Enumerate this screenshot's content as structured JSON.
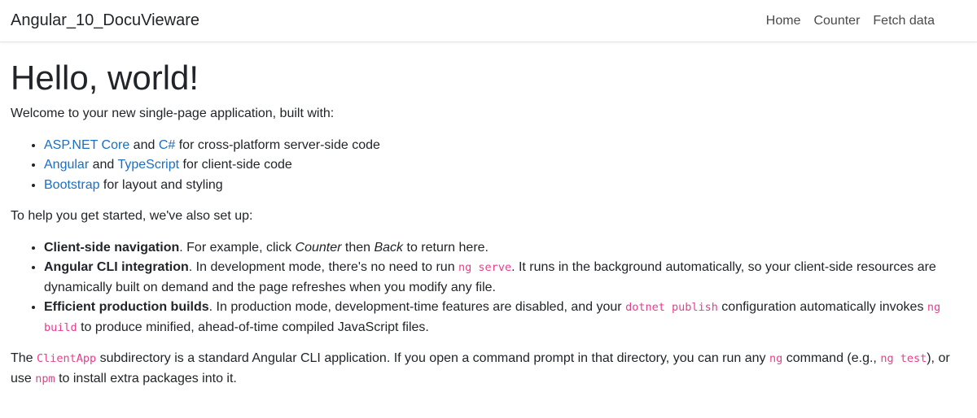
{
  "navbar": {
    "brand": "Angular_10_DocuVieware",
    "links": [
      "Home",
      "Counter",
      "Fetch data"
    ]
  },
  "main": {
    "title": "Hello, world!",
    "intro": "Welcome to your new single-page application, built with:",
    "built_with": [
      {
        "link1": "ASP.NET Core",
        "mid": " and ",
        "link2": "C#",
        "rest": " for cross-platform server-side code"
      },
      {
        "link1": "Angular",
        "mid": " and ",
        "link2": "TypeScript",
        "rest": " for client-side code"
      },
      {
        "link1": "Bootstrap",
        "rest": " for layout and styling"
      }
    ],
    "setup_intro": "To help you get started, we've also set up:",
    "setup_items": [
      {
        "strong": "Client-side navigation",
        "t1": ". For example, click ",
        "em1": "Counter",
        "t2": " then ",
        "em2": "Back",
        "t3": " to return here."
      },
      {
        "strong": "Angular CLI integration",
        "t1": ". In development mode, there's no need to run ",
        "code1": "ng serve",
        "t2": ". It runs in the background automatically, so your client-side resources are dynamically built on demand and the page refreshes when you modify any file."
      },
      {
        "strong": "Efficient production builds",
        "t1": ". In production mode, development-time features are disabled, and your ",
        "code1": "dotnet publish",
        "t2": " configuration automatically invokes ",
        "code2": "ng build",
        "t3": " to produce minified, ahead-of-time compiled JavaScript files."
      }
    ],
    "footer": {
      "t0": "The ",
      "code1": "ClientApp",
      "t1": " subdirectory is a standard Angular CLI application. If you open a command prompt in that directory, you can run any ",
      "code2": "ng",
      "t2": " command (e.g., ",
      "code3": "ng test",
      "t3": "), or use ",
      "code4": "npm",
      "t4": " to install extra packages into it."
    }
  },
  "colors": {
    "link": "#1b6ec2",
    "code": "#e83e8c",
    "text": "#212529"
  }
}
